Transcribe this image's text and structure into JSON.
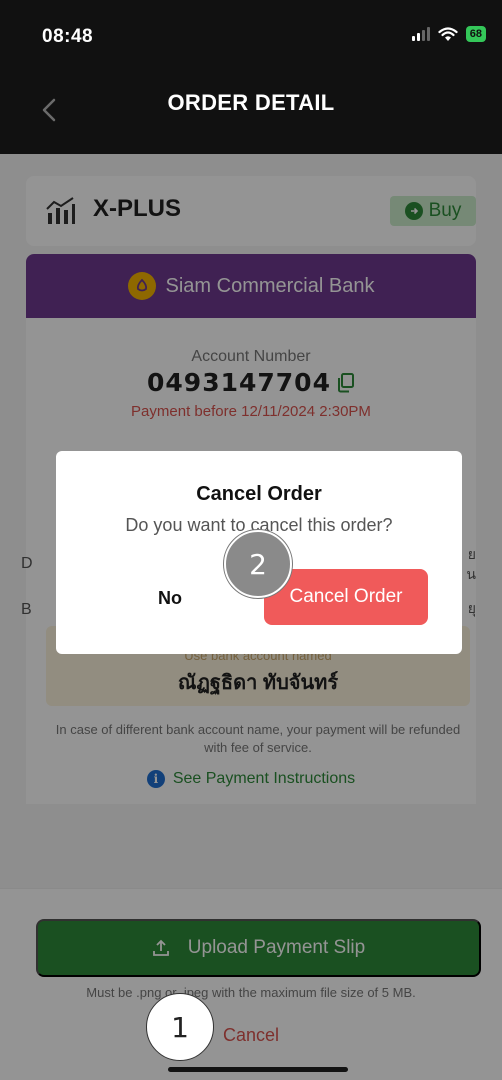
{
  "status_bar": {
    "time": "08:48",
    "battery": "68"
  },
  "nav": {
    "title": "ORDER DETAIL"
  },
  "product": {
    "name": "X-PLUS",
    "action": "Buy"
  },
  "bank": {
    "name": "Siam Commercial Bank"
  },
  "account": {
    "label": "Account Number",
    "number": "0493147704",
    "deadline": "Payment before 12/11/2024 2:30PM"
  },
  "partial_text": {
    "left1": "D",
    "left2": "B",
    "right1": "ย",
    "right2": "น",
    "right3": "ยุ"
  },
  "use_account": {
    "label": "Use bank account named",
    "name": "ณัฏฐธิดา ทับจันทร์"
  },
  "refund_note": "In case of different bank account name, your payment will be refunded with fee of service.",
  "instructions_link": "See Payment Instructions",
  "upload": {
    "label": "Upload Payment Slip",
    "note": "Must be .png or .jpeg with the maximum file size of 5 MB."
  },
  "cancel_link": "Cancel",
  "dialog": {
    "title": "Cancel Order",
    "message": "Do you want to cancel this order?",
    "no_label": "No",
    "confirm_label": "Cancel Order"
  },
  "markers": {
    "step1": "1",
    "step2": "2"
  },
  "colors": {
    "brand_green": "#2e8b3a",
    "bank_purple": "#6e3a8f",
    "danger_red": "#f05a5a"
  }
}
